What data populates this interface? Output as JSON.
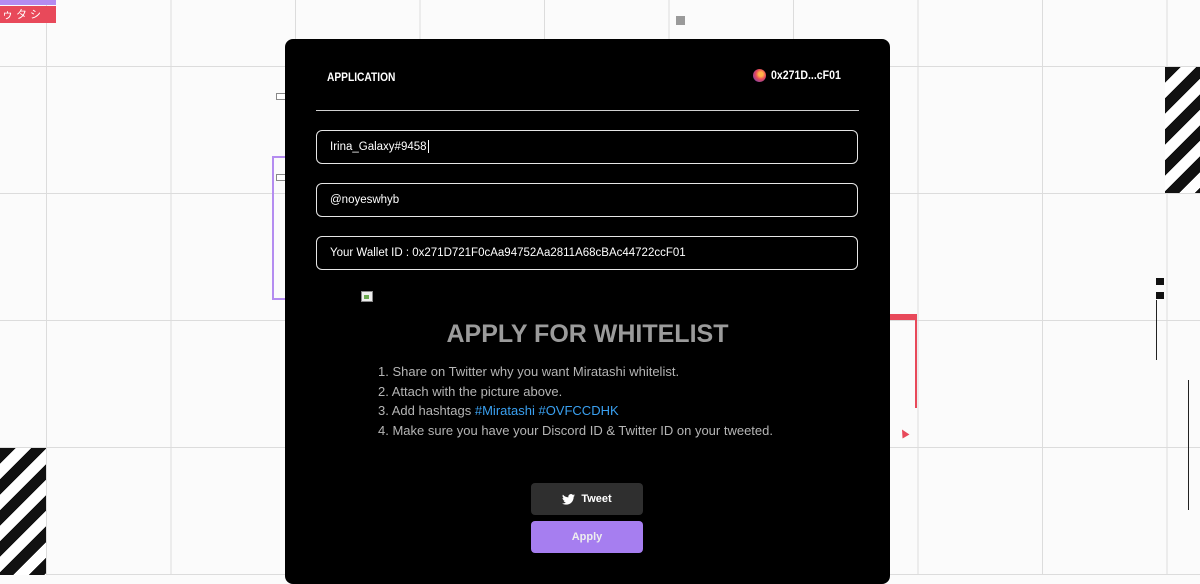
{
  "background": {
    "tag_text": "ゥタシ",
    "accent_red": "#e8495a",
    "accent_purple": "#b48cf0"
  },
  "modal": {
    "title": "APPLICATION",
    "wallet_short": "0x271D...cF01",
    "fields": {
      "discord_value": "Irina_Galaxy#9458",
      "twitter_value": "@noyeswhyb",
      "wallet_value": "Your Wallet ID : 0x271D721F0cAa94752Aa2811A68cBAc44722ccF01"
    },
    "headline": "APPLY FOR WHITELIST",
    "steps": [
      "1. Share on Twitter why you want Miratashi whitelist.",
      "2. Attach with the picture above.",
      "3. Add hashtags",
      "4. Make sure you have your Discord ID & Twitter ID on your tweeted."
    ],
    "hashtags": [
      "#Miratashi",
      "#OVFCCDHK"
    ],
    "buttons": {
      "tweet_label": "Tweet",
      "apply_label": "Apply"
    },
    "colors": {
      "apply_button": "#a67ef0",
      "tweet_button": "#2f2f2f",
      "hashtag": "#3aa0f0"
    }
  }
}
